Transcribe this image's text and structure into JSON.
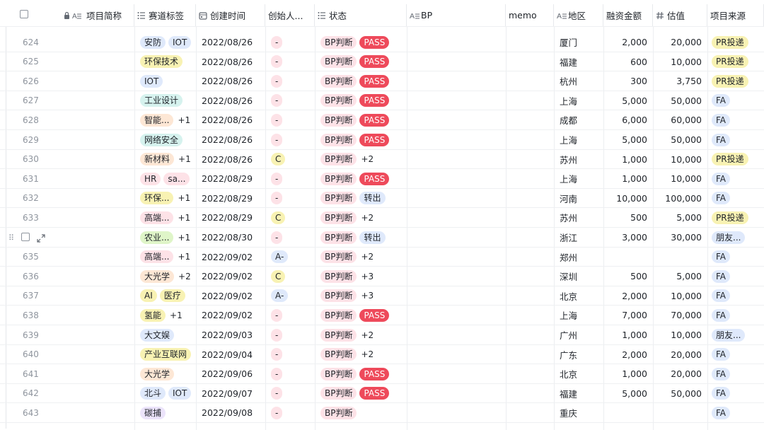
{
  "columns": [
    {
      "key": "select",
      "label": "",
      "icon": "checkbox"
    },
    {
      "key": "name",
      "label": "项目简称",
      "icon": "lock-text-icon"
    },
    {
      "key": "track",
      "label": "赛道标签",
      "icon": "multi-select-icon"
    },
    {
      "key": "date",
      "label": "创建时间",
      "icon": "calendar-icon"
    },
    {
      "key": "founder",
      "label": "创始人...",
      "icon": ""
    },
    {
      "key": "status",
      "label": "状态",
      "icon": "multi-select-icon"
    },
    {
      "key": "bp",
      "label": "BP",
      "icon": "text-icon"
    },
    {
      "key": "memo",
      "label": "memo",
      "icon": ""
    },
    {
      "key": "region",
      "label": "地区",
      "icon": "text-icon"
    },
    {
      "key": "amount",
      "label": "融资金额",
      "icon": ""
    },
    {
      "key": "valuation",
      "label": "估值",
      "icon": "number-icon"
    },
    {
      "key": "source",
      "label": "项目来源",
      "icon": ""
    }
  ],
  "colors": {
    "pink": "#fde2e7",
    "yellow": "#f8f2b3",
    "green": "#dff5c8",
    "blue": "#dfe9fb",
    "teal": "#d6f2ee",
    "pass": "#ee4a5b",
    "orange": "#fde7d5",
    "purple": "#ece4fb"
  },
  "rows": [
    {
      "idx": "624",
      "tags": [
        {
          "t": "安防",
          "c": "blue"
        },
        {
          "t": "IOT",
          "c": "blue"
        }
      ],
      "more": "",
      "date": "2022/08/26",
      "founder": {
        "t": "-",
        "c": "pink"
      },
      "status": [
        {
          "t": "BP判断",
          "c": "pink"
        },
        {
          "t": "PASS",
          "c": "pass"
        }
      ],
      "region": "厦门",
      "amount": "2,000",
      "valuation": "20,000",
      "source": {
        "t": "PR投递",
        "c": "yellow"
      }
    },
    {
      "idx": "625",
      "tags": [
        {
          "t": "环保技术",
          "c": "yellow"
        }
      ],
      "more": "",
      "date": "2022/08/26",
      "founder": {
        "t": "-",
        "c": "pink"
      },
      "status": [
        {
          "t": "BP判断",
          "c": "pink"
        },
        {
          "t": "PASS",
          "c": "pass"
        }
      ],
      "region": "福建",
      "amount": "600",
      "valuation": "10,000",
      "source": {
        "t": "PR投递",
        "c": "yellow"
      }
    },
    {
      "idx": "626",
      "tags": [
        {
          "t": "IOT",
          "c": "blue"
        }
      ],
      "more": "",
      "date": "2022/08/26",
      "founder": {
        "t": "-",
        "c": "pink"
      },
      "status": [
        {
          "t": "BP判断",
          "c": "pink"
        },
        {
          "t": "PASS",
          "c": "pass"
        }
      ],
      "region": "杭州",
      "amount": "300",
      "valuation": "3,750",
      "source": {
        "t": "PR投递",
        "c": "yellow"
      }
    },
    {
      "idx": "627",
      "tags": [
        {
          "t": "工业设计",
          "c": "teal"
        }
      ],
      "more": "",
      "date": "2022/08/26",
      "founder": {
        "t": "-",
        "c": "pink"
      },
      "status": [
        {
          "t": "BP判断",
          "c": "pink"
        },
        {
          "t": "PASS",
          "c": "pass"
        }
      ],
      "region": "上海",
      "amount": "5,000",
      "valuation": "50,000",
      "source": {
        "t": "FA",
        "c": "blue"
      }
    },
    {
      "idx": "628",
      "tags": [
        {
          "t": "智能...",
          "c": "orange"
        }
      ],
      "more": "+1",
      "date": "2022/08/26",
      "founder": {
        "t": "-",
        "c": "pink"
      },
      "status": [
        {
          "t": "BP判断",
          "c": "pink"
        },
        {
          "t": "PASS",
          "c": "pass"
        }
      ],
      "region": "成都",
      "amount": "6,000",
      "valuation": "60,000",
      "source": {
        "t": "FA",
        "c": "blue"
      }
    },
    {
      "idx": "629",
      "tags": [
        {
          "t": "网络安全",
          "c": "teal"
        }
      ],
      "more": "",
      "date": "2022/08/26",
      "founder": {
        "t": "-",
        "c": "pink"
      },
      "status": [
        {
          "t": "BP判断",
          "c": "pink"
        },
        {
          "t": "PASS",
          "c": "pass"
        }
      ],
      "region": "上海",
      "amount": "5,000",
      "valuation": "50,000",
      "source": {
        "t": "FA",
        "c": "blue"
      }
    },
    {
      "idx": "630",
      "tags": [
        {
          "t": "新材料",
          "c": "orange"
        }
      ],
      "more": "+1",
      "date": "2022/08/26",
      "founder": {
        "t": "C",
        "c": "yellow"
      },
      "status": [
        {
          "t": "BP判断",
          "c": "pink"
        },
        {
          "t": "+2",
          "c": "none"
        }
      ],
      "region": "苏州",
      "amount": "1,000",
      "valuation": "10,000",
      "source": {
        "t": "PR投递",
        "c": "yellow"
      }
    },
    {
      "idx": "631",
      "tags": [
        {
          "t": "HR",
          "c": "pink"
        },
        {
          "t": "sa...",
          "c": "pink"
        }
      ],
      "more": "",
      "date": "2022/08/29",
      "founder": {
        "t": "-",
        "c": "pink"
      },
      "status": [
        {
          "t": "BP判断",
          "c": "pink"
        },
        {
          "t": "PASS",
          "c": "pass"
        }
      ],
      "region": "上海",
      "amount": "1,000",
      "valuation": "10,000",
      "source": {
        "t": "FA",
        "c": "blue"
      }
    },
    {
      "idx": "632",
      "tags": [
        {
          "t": "环保...",
          "c": "yellow"
        }
      ],
      "more": "+1",
      "date": "2022/08/29",
      "founder": {
        "t": "-",
        "c": "pink"
      },
      "status": [
        {
          "t": "BP判断",
          "c": "pink"
        },
        {
          "t": "转出",
          "c": "blue"
        }
      ],
      "region": "河南",
      "amount": "10,000",
      "valuation": "100,000",
      "source": {
        "t": "FA",
        "c": "blue"
      }
    },
    {
      "idx": "633",
      "tags": [
        {
          "t": "高端...",
          "c": "pink"
        }
      ],
      "more": "+1",
      "date": "2022/08/29",
      "founder": {
        "t": "C",
        "c": "yellow"
      },
      "status": [
        {
          "t": "BP判断",
          "c": "pink"
        },
        {
          "t": "+2",
          "c": "none"
        }
      ],
      "region": "苏州",
      "amount": "500",
      "valuation": "5,000",
      "source": {
        "t": "PR投递",
        "c": "yellow"
      }
    },
    {
      "idx": "634",
      "tags": [
        {
          "t": "农业...",
          "c": "green"
        }
      ],
      "more": "+1",
      "date": "2022/08/30",
      "founder": {
        "t": "-",
        "c": "pink"
      },
      "status": [
        {
          "t": "BP判断",
          "c": "pink"
        },
        {
          "t": "转出",
          "c": "blue"
        }
      ],
      "region": "浙江",
      "amount": "3,000",
      "valuation": "30,000",
      "source": {
        "t": "朋友...",
        "c": "blue"
      },
      "hovered": true
    },
    {
      "idx": "635",
      "tags": [
        {
          "t": "高端...",
          "c": "pink"
        }
      ],
      "more": "+1",
      "date": "2022/09/02",
      "founder": {
        "t": "A-",
        "c": "blue"
      },
      "status": [
        {
          "t": "BP判断",
          "c": "pink"
        },
        {
          "t": "+2",
          "c": "none"
        }
      ],
      "region": "郑州",
      "amount": "",
      "valuation": "",
      "source": {
        "t": "FA",
        "c": "blue"
      }
    },
    {
      "idx": "636",
      "tags": [
        {
          "t": "大光学",
          "c": "orange"
        }
      ],
      "more": "+2",
      "date": "2022/09/02",
      "founder": {
        "t": "C",
        "c": "yellow"
      },
      "status": [
        {
          "t": "BP判断",
          "c": "pink"
        },
        {
          "t": "+3",
          "c": "none"
        }
      ],
      "region": "深圳",
      "amount": "500",
      "valuation": "5,000",
      "source": {
        "t": "FA",
        "c": "blue"
      }
    },
    {
      "idx": "637",
      "tags": [
        {
          "t": "AI",
          "c": "yellow"
        },
        {
          "t": "医疗",
          "c": "yellow"
        }
      ],
      "more": "",
      "date": "2022/09/02",
      "founder": {
        "t": "A-",
        "c": "blue"
      },
      "status": [
        {
          "t": "BP判断",
          "c": "pink"
        },
        {
          "t": "+3",
          "c": "none"
        }
      ],
      "region": "北京",
      "amount": "2,000",
      "valuation": "10,000",
      "source": {
        "t": "FA",
        "c": "blue"
      }
    },
    {
      "idx": "638",
      "tags": [
        {
          "t": "氢能",
          "c": "yellow"
        }
      ],
      "more": "+1",
      "date": "2022/09/02",
      "founder": {
        "t": "-",
        "c": "pink"
      },
      "status": [
        {
          "t": "BP判断",
          "c": "pink"
        },
        {
          "t": "PASS",
          "c": "pass"
        }
      ],
      "region": "上海",
      "amount": "7,000",
      "valuation": "70,000",
      "source": {
        "t": "FA",
        "c": "blue"
      }
    },
    {
      "idx": "639",
      "tags": [
        {
          "t": "大文娱",
          "c": "blue"
        }
      ],
      "more": "",
      "date": "2022/09/03",
      "founder": {
        "t": "-",
        "c": "pink"
      },
      "status": [
        {
          "t": "BP判断",
          "c": "pink"
        },
        {
          "t": "+2",
          "c": "none"
        }
      ],
      "region": "广州",
      "amount": "1,000",
      "valuation": "10,000",
      "source": {
        "t": "朋友...",
        "c": "blue"
      }
    },
    {
      "idx": "640",
      "tags": [
        {
          "t": "产业互联网",
          "c": "yellow"
        }
      ],
      "more": "",
      "date": "2022/09/04",
      "founder": {
        "t": "-",
        "c": "pink"
      },
      "status": [
        {
          "t": "BP判断",
          "c": "pink"
        },
        {
          "t": "+2",
          "c": "none"
        }
      ],
      "region": "广东",
      "amount": "2,000",
      "valuation": "20,000",
      "source": {
        "t": "FA",
        "c": "blue"
      }
    },
    {
      "idx": "641",
      "tags": [
        {
          "t": "大光学",
          "c": "orange"
        }
      ],
      "more": "",
      "date": "2022/09/06",
      "founder": {
        "t": "-",
        "c": "pink"
      },
      "status": [
        {
          "t": "BP判断",
          "c": "pink"
        },
        {
          "t": "PASS",
          "c": "pass"
        }
      ],
      "region": "北京",
      "amount": "1,000",
      "valuation": "20,000",
      "source": {
        "t": "FA",
        "c": "blue"
      }
    },
    {
      "idx": "642",
      "tags": [
        {
          "t": "北斗",
          "c": "blue"
        },
        {
          "t": "IOT",
          "c": "blue"
        }
      ],
      "more": "",
      "date": "2022/09/07",
      "founder": {
        "t": "-",
        "c": "pink"
      },
      "status": [
        {
          "t": "BP判断",
          "c": "pink"
        },
        {
          "t": "PASS",
          "c": "pass"
        }
      ],
      "region": "福建",
      "amount": "5,000",
      "valuation": "50,000",
      "source": {
        "t": "FA",
        "c": "blue"
      }
    },
    {
      "idx": "643",
      "tags": [
        {
          "t": "碳捕",
          "c": "purple"
        }
      ],
      "more": "",
      "date": "2022/09/08",
      "founder": {
        "t": "-",
        "c": "pink"
      },
      "status": [
        {
          "t": "BP判断",
          "c": "pink"
        }
      ],
      "region": "重庆",
      "amount": "",
      "valuation": "",
      "source": {
        "t": "FA",
        "c": "blue"
      }
    }
  ]
}
